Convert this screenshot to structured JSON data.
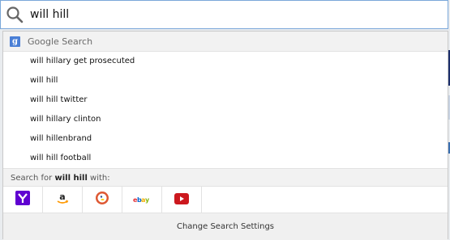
{
  "search": {
    "query": "will hill",
    "search_icon": "magnifier-icon"
  },
  "engine_header": {
    "icon": "google-g-icon",
    "icon_letter": "g",
    "label": "Google Search"
  },
  "suggestions": [
    "will hillary get prosecuted",
    "will hill",
    "will hill twitter",
    "will hillary clinton",
    "will hillenbrand",
    "will hill football"
  ],
  "search_with": {
    "prefix": "Search for ",
    "query": "will hill",
    "suffix": " with:"
  },
  "engines": [
    {
      "name": "Yahoo",
      "icon": "yahoo-icon",
      "color": "#5f01d1"
    },
    {
      "name": "Amazon",
      "icon": "amazon-icon",
      "color": "#f90"
    },
    {
      "name": "DuckDuckGo",
      "icon": "duckduckgo-icon",
      "color": "#de5833"
    },
    {
      "name": "eBay",
      "icon": "ebay-icon",
      "color": "#0064d2"
    },
    {
      "name": "YouTube",
      "icon": "youtube-icon",
      "color": "#cc181e"
    }
  ],
  "footer": {
    "change_settings_label": "Change Search Settings"
  }
}
